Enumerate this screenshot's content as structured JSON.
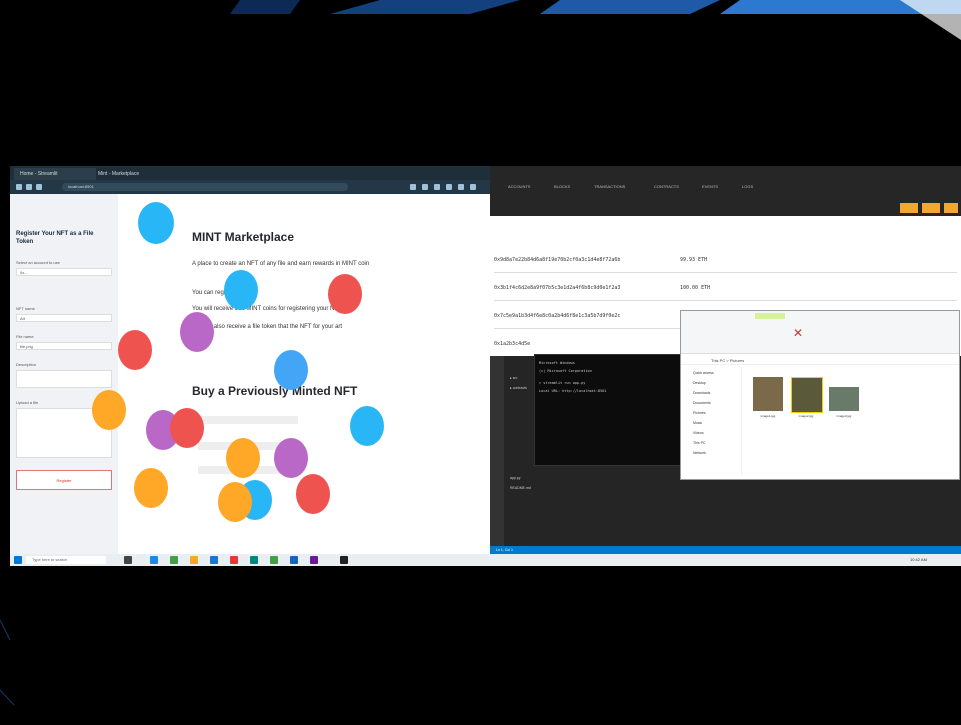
{
  "browser": {
    "tabs": [
      "Home - Streamlit",
      "Mint - Marketplace"
    ],
    "address": "localhost:8501",
    "sidebar": {
      "title": "Register Your NFT as a File Token",
      "labels": [
        "Select an account to use",
        "Account",
        "NFT name",
        "File name",
        "Description",
        "Upload a file"
      ],
      "values": [
        "0x...",
        "Art",
        "file.png"
      ],
      "button": "Register"
    },
    "page": {
      "title": "MINT Marketplace",
      "intro": "A place to create an NFT of any file and earn rewards in MINT coin",
      "line2": "You can register",
      "line3": "You will receive 500 MINT coins for registering your NFT",
      "line4": "You will also receive a file token that the NFT for your art",
      "subtitle": "Buy a Previously Minted NFT"
    }
  },
  "taskbar": {
    "search": "Type here to search",
    "time": "10:42 AM"
  },
  "app": {
    "nav": [
      "ACCOUNTS",
      "BLOCKS",
      "TRANSACTIONS",
      "CONTRACTS",
      "EVENTS",
      "LOGS"
    ],
    "rows": [
      {
        "hash": "0x9d8a7e22b84d6a8f19e70b2cf0a3c1d4e8f72a6b",
        "amount": "99.93 ETH"
      },
      {
        "hash": "0x3b1f4c6d2e8a9f07b5c3e1d2a4f6b8c9d0e1f2a3",
        "amount": "100.00 ETH"
      },
      {
        "hash": "0x7c5e9a1b3d4f6e8c0a2b4d6f8e1c3a5b7d9f0e2c",
        "amount": ""
      },
      {
        "hash": "0x1a2b3c4d5e",
        "amount": ""
      }
    ],
    "explorer": {
      "path": "This PC > Pictures",
      "nav": [
        "Quick access",
        "Desktop",
        "Downloads",
        "Documents",
        "Pictures",
        "Music",
        "Videos",
        "This PC",
        "Network"
      ],
      "files": [
        "image1.jpg",
        "image2.jpg",
        "image3.jpg"
      ]
    },
    "terminal": [
      "Microsoft Windows",
      "(c) Microsoft Corporation",
      "> streamlit run app.py",
      "Local URL: http://localhost:8501"
    ],
    "status": "Ln 1, Col 1"
  }
}
